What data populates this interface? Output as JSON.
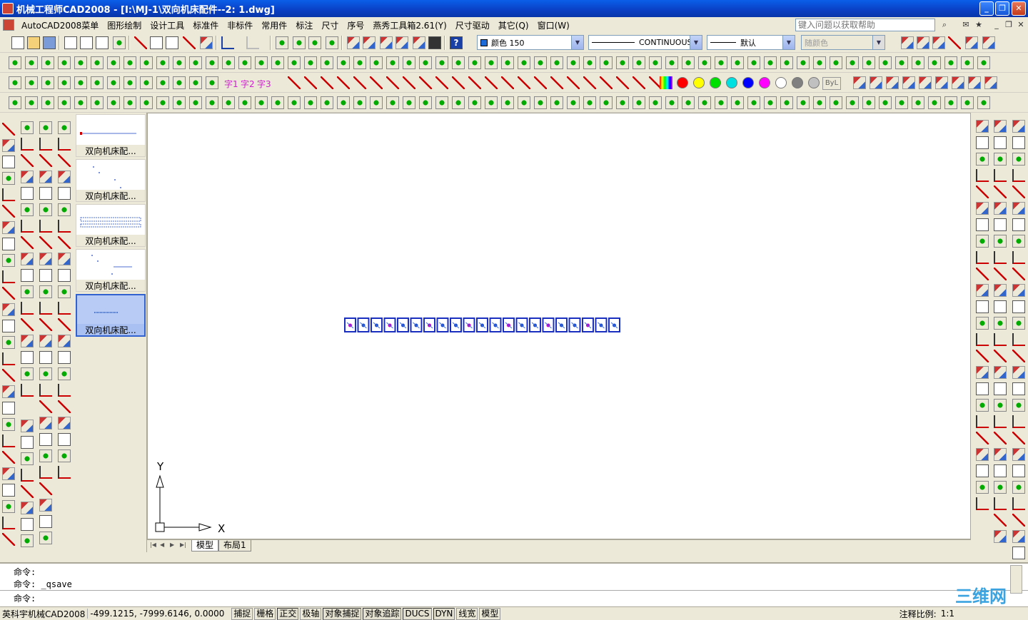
{
  "window": {
    "title": "机械工程师CAD2008 - [I:\\MJ-1\\双向机床配件--2: 1.dwg]",
    "minimize": "_",
    "restore": "❐",
    "close": "✕"
  },
  "menu": {
    "items": [
      "AutoCAD2008菜单",
      "图形绘制",
      "设计工具",
      "标准件",
      "非标件",
      "常用件",
      "标注",
      "尺寸",
      "序号",
      "燕秀工具箱2.61(Y)",
      "尺寸驱动",
      "其它(Q)",
      "窗口(W)"
    ],
    "help_placeholder": "键入问题以获取帮助"
  },
  "properties": {
    "color": "颜色 150",
    "color_hex": "#1c6bd9",
    "linetype": "CONTINUOUS",
    "lineweight": "默认",
    "plotstyle": "随颜色"
  },
  "toolbar_text": {
    "text1": "字1",
    "text2": "字2",
    "text3": "字3",
    "bylayer": "ByL"
  },
  "palette_colors": [
    "#ff0000",
    "#ffff00",
    "#00e000",
    "#00e0e0",
    "#0000ff",
    "#ff00ff",
    "#ffffff",
    "#808080",
    "#c0c0c0"
  ],
  "sheets": {
    "items": [
      {
        "label": "双向机床配..."
      },
      {
        "label": "双向机床配..."
      },
      {
        "label": "双向机床配..."
      },
      {
        "label": "双向机床配..."
      },
      {
        "label": "双向机床配..."
      }
    ]
  },
  "canvas": {
    "axis_y": "Y",
    "axis_x": "X"
  },
  "tabs": {
    "model": "模型",
    "layout1": "布局1"
  },
  "command": {
    "line1": "命令:",
    "line2": "命令: _qsave",
    "line3": "命令:"
  },
  "status": {
    "app": "英科宇机械CAD2008",
    "coords": "-499.1215,  -7999.6146, 0.0000",
    "buttons": [
      "捕捉",
      "栅格",
      "正交",
      "极轴",
      "对象捕捉",
      "对象追踪",
      "DUCS",
      "DYN",
      "线宽",
      "模型"
    ],
    "scale_label": "注释比例:",
    "scale_value": "1:1"
  },
  "watermark": "三维网"
}
